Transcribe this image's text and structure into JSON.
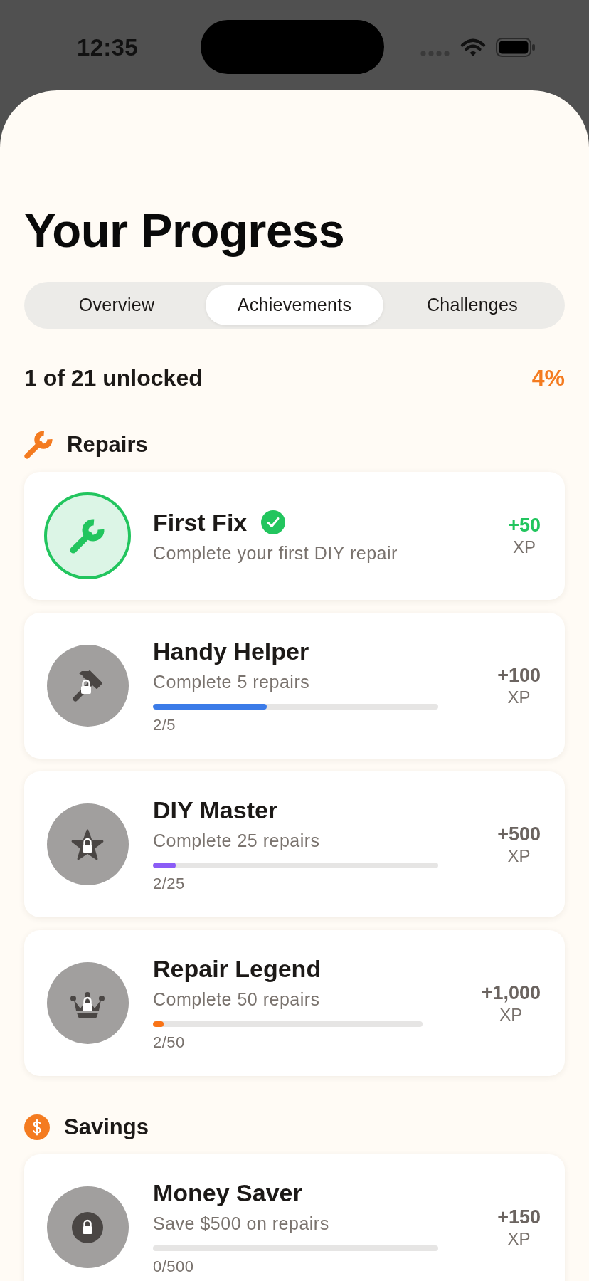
{
  "status_bar": {
    "time": "12:35"
  },
  "title": "Your Progress",
  "tabs": [
    {
      "label": "Overview",
      "selected": false
    },
    {
      "label": "Achievements",
      "selected": true
    },
    {
      "label": "Challenges",
      "selected": false
    }
  ],
  "summary": {
    "unlocked": "1 of 21 unlocked",
    "percent": "4%"
  },
  "sections": [
    {
      "title": "Repairs",
      "achievements": [
        {
          "title": "First Fix",
          "description": "Complete your first DIY repair",
          "unlocked": true,
          "xp": "+50",
          "xp_unit": "XP"
        },
        {
          "title": "Handy Helper",
          "description": "Complete 5 repairs",
          "unlocked": false,
          "level": 0.4,
          "progress": "2/5",
          "color": "#3b7be8",
          "xp": "+100",
          "xp_unit": "XP"
        },
        {
          "title": "DIY Master",
          "description": "Complete 25 repairs",
          "unlocked": false,
          "level": 0.08,
          "progress": "2/25",
          "color": "#8b5cf6",
          "xp": "+500",
          "xp_unit": "XP"
        },
        {
          "title": "Repair Legend",
          "description": "Complete 50 repairs",
          "unlocked": false,
          "level": 0.04,
          "progress": "2/50",
          "color": "#f97316",
          "xp": "+1,000",
          "xp_unit": "XP"
        }
      ]
    },
    {
      "title": "Savings",
      "achievements": [
        {
          "title": "Money Saver",
          "description": "Save $500 on repairs",
          "unlocked": false,
          "level": 0,
          "progress": "0/500",
          "xp": "+150",
          "xp_unit": "XP"
        }
      ]
    }
  ]
}
